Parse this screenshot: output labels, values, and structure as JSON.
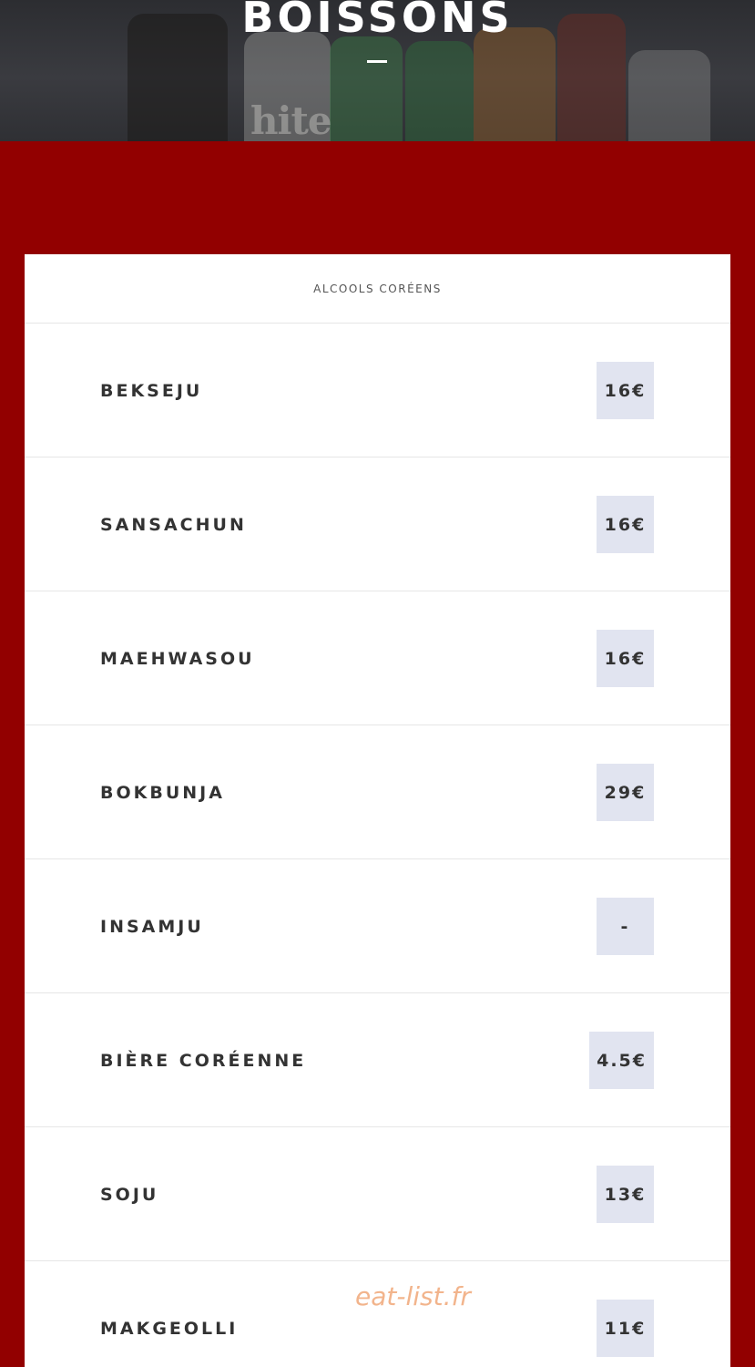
{
  "hero": {
    "title": "BOISSONS",
    "bottle_label": "hite"
  },
  "card": {
    "category": "ALCOOLS CORÉENS",
    "items": [
      {
        "name": "BEKSEJU",
        "price": "16€"
      },
      {
        "name": "SANSACHUN",
        "price": "16€"
      },
      {
        "name": "MAEHWASOU",
        "price": "16€"
      },
      {
        "name": "BOKBUNJA",
        "price": "29€"
      },
      {
        "name": "INSAMJU",
        "price": "-"
      },
      {
        "name": "BIÈRE CORÉENNE",
        "price": "4.5€"
      },
      {
        "name": "SOJU",
        "price": "13€"
      },
      {
        "name": "MAKGEOLLI",
        "price": "11€"
      }
    ]
  },
  "watermark": "eat-list.fr",
  "colors": {
    "page_background": "#920000",
    "card_background": "#ffffff",
    "price_background": "#e1e4f0",
    "text": "#333333"
  }
}
